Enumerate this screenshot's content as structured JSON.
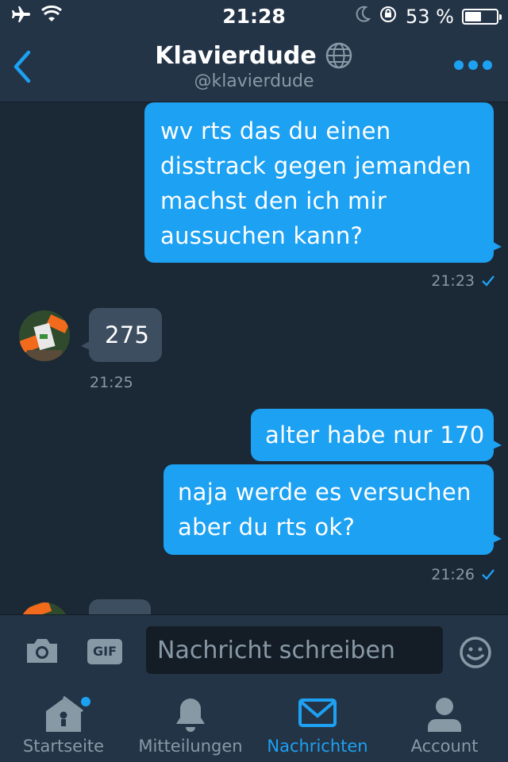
{
  "status_bar": {
    "time": "21:28",
    "battery_text": "53 %",
    "battery_level": 0.53,
    "icons": [
      "airplane-icon",
      "wifi-icon",
      "moon-icon",
      "rotation-lock-icon",
      "battery-icon"
    ]
  },
  "header": {
    "name": "Klavierdude",
    "handle": "@klavierdude",
    "back_icon": "chevron-left-icon",
    "more_icon": "more-dots-icon",
    "badge_icon": "globe-icon"
  },
  "messages": [
    {
      "direction": "outgoing",
      "text": "wv rts das du einen\ndisstrack gegen jemanden\nmachst den ich mir\naussuchen kann?"
    },
    {
      "direction": "outgoing_meta",
      "time": "21:23",
      "read": true
    },
    {
      "direction": "incoming",
      "text": "275"
    },
    {
      "direction": "incoming_meta",
      "time": "21:25"
    },
    {
      "direction": "outgoing",
      "text": "alter habe nur 170"
    },
    {
      "direction": "outgoing",
      "text": "naja werde es versuchen\naber du rts ok?"
    },
    {
      "direction": "outgoing_meta",
      "time": "21:26",
      "read": true
    }
  ],
  "composer": {
    "placeholder": "Nachricht schreiben",
    "gif_label": "GIF",
    "camera_icon": "camera-icon",
    "emoji_icon": "emoji-icon"
  },
  "tabs": [
    {
      "label": "Startseite",
      "icon": "home-icon",
      "active": false,
      "has_dot": true
    },
    {
      "label": "Mitteilungen",
      "icon": "bell-icon",
      "active": false,
      "has_dot": false
    },
    {
      "label": "Nachrichten",
      "icon": "envelope-icon",
      "active": true,
      "has_dot": false
    },
    {
      "label": "Account",
      "icon": "person-icon",
      "active": false,
      "has_dot": false
    }
  ],
  "colors": {
    "accent": "#1da1f2",
    "background": "#1b2836",
    "bar": "#243447",
    "incoming_bubble": "#3d4e60",
    "muted": "#8899a6"
  }
}
